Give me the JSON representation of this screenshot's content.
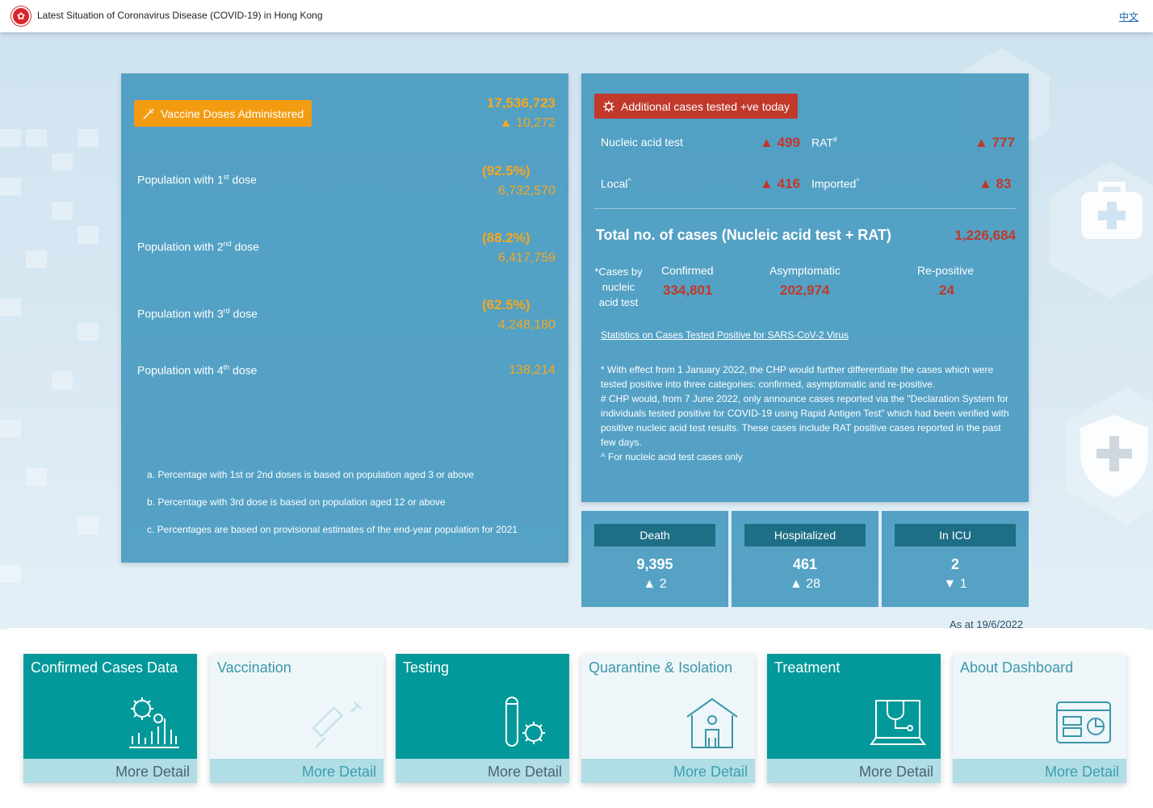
{
  "header": {
    "title": "Latest Situation of Coronavirus Disease (COVID-19) in Hong Kong",
    "lang": "中文"
  },
  "vaccine": {
    "badge": "Vaccine Doses Administered",
    "total": "17,536,723",
    "delta": "▲ 10,272",
    "doses": [
      {
        "prefix": "Population with 1",
        "sup": "st",
        "suffix": " dose",
        "pct": "(92.5%)",
        "count": "6,732,570"
      },
      {
        "prefix": "Population with 2",
        "sup": "nd",
        "suffix": " dose",
        "pct": "(88.2%)",
        "count": "6,417,759"
      },
      {
        "prefix": "Population with 3",
        "sup": "rd",
        "suffix": " dose",
        "pct": "(62.5%)",
        "count": "4,248,180"
      },
      {
        "prefix": "Population with 4",
        "sup": "th",
        "suffix": " dose",
        "pct": "",
        "count": "138,214"
      }
    ],
    "notes": [
      "a. Percentage with 1st or 2nd doses is based on population aged 3 or above",
      "b. Percentage with 3rd dose is based on population aged 12 or above",
      "c. Percentages are based on provisional estimates of the end-year population for 2021"
    ]
  },
  "cases": {
    "badge": "Additional cases tested +ve today",
    "nucleic_label": "Nucleic acid test",
    "nucleic_val": "▲ 499",
    "rat_label": "RAT",
    "rat_sup": "#",
    "rat_val": "▲ 777",
    "local_label": "Local",
    "local_sup": "^",
    "local_val": "▲ 416",
    "imported_label": "Imported",
    "imported_sup": "^",
    "imported_val": "▲ 83",
    "total_label": "Total no. of cases (Nucleic acid test + RAT)",
    "total_val": "1,226,684",
    "by_test_label_1": "*Cases by",
    "by_test_label_2": "nucleic",
    "by_test_label_3": "acid test",
    "confirmed_label": "Confirmed",
    "confirmed_val": "334,801",
    "asym_label": "Asymptomatic",
    "asym_val": "202,974",
    "repos_label": "Re-positive",
    "repos_val": "24",
    "stats_link": "Statistics on Cases Tested Positive for SARS-CoV-2 Virus",
    "footnote_1": "* With effect from 1 January 2022, the CHP would further differentiate the cases which were tested positive into three categories: confirmed, asymptomatic and re-positive.",
    "footnote_2": "# CHP would, from 7 June 2022, only announce cases reported via the \"Declaration System for individuals tested positive for COVID-19 using Rapid Antigen Test\" which had been verified with positive nucleic acid test results. These cases include RAT positive cases reported in the past few days.",
    "footnote_3": "^ For nucleic acid test cases only"
  },
  "mini": [
    {
      "label": "Death",
      "value": "9,395",
      "delta": "▲ 2"
    },
    {
      "label": "Hospitalized",
      "value": "461",
      "delta": "▲ 28"
    },
    {
      "label": "In ICU",
      "value": "2",
      "delta": "▼ 1"
    }
  ],
  "as_at": "As at 19/6/2022",
  "cards": [
    {
      "title": "Confirmed Cases Data",
      "foot": "More Detail",
      "style": "dark"
    },
    {
      "title": "Vaccination",
      "foot": "More Detail",
      "style": "light"
    },
    {
      "title": "Testing",
      "foot": "More Detail",
      "style": "dark"
    },
    {
      "title": "Quarantine & Isolation",
      "foot": "More Detail",
      "style": "light"
    },
    {
      "title": "Treatment",
      "foot": "More Detail",
      "style": "dark"
    },
    {
      "title": "About Dashboard",
      "foot": "More Detail",
      "style": "light"
    }
  ],
  "colors": {
    "panel": "#3c94bc",
    "orange": "#f39c12",
    "red": "#c0392b",
    "teal": "#03999a"
  }
}
